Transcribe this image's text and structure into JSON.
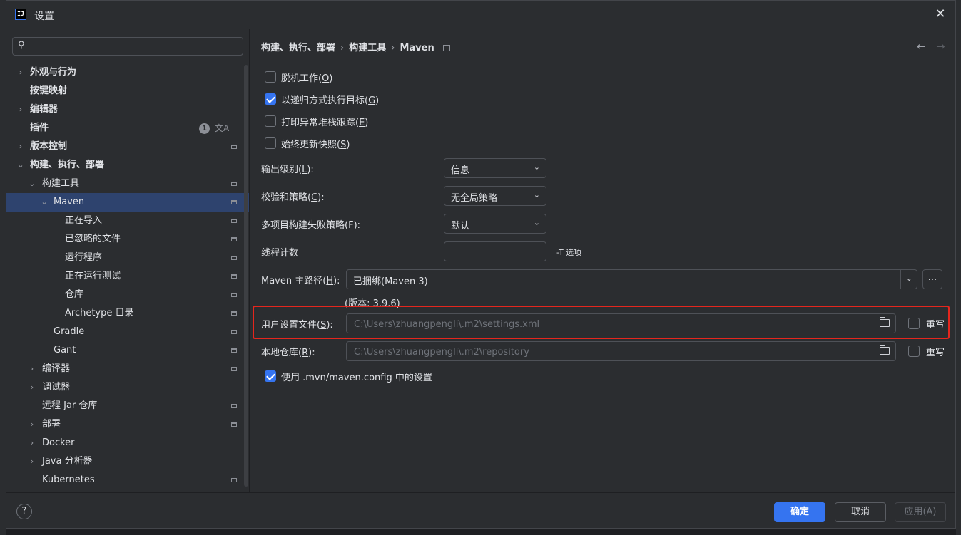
{
  "window": {
    "title": "设置",
    "app_icon": "IJ"
  },
  "search": {
    "placeholder": "",
    "value": ""
  },
  "sidebar": {
    "items": [
      {
        "label": "外观与行为"
      },
      {
        "label": "按键映射"
      },
      {
        "label": "编辑器"
      },
      {
        "label": "插件",
        "badge": "1"
      },
      {
        "label": "版本控制"
      },
      {
        "label": "构建、执行、部署"
      },
      {
        "label": "构建工具"
      },
      {
        "label": "Maven"
      },
      {
        "label": "正在导入"
      },
      {
        "label": "已忽略的文件"
      },
      {
        "label": "运行程序"
      },
      {
        "label": "正在运行测试"
      },
      {
        "label": "仓库"
      },
      {
        "label": "Archetype 目录"
      },
      {
        "label": "Gradle"
      },
      {
        "label": "Gant"
      },
      {
        "label": "编译器"
      },
      {
        "label": "调试器"
      },
      {
        "label": "远程 Jar 仓库"
      },
      {
        "label": "部署"
      },
      {
        "label": "Docker"
      },
      {
        "label": "Java 分析器"
      },
      {
        "label": "Kubernetes"
      }
    ]
  },
  "breadcrumb": {
    "part1": "构建、执行、部署",
    "part2": "构建工具",
    "part3": "Maven",
    "sep": "›"
  },
  "options": {
    "offline": {
      "label": "脱机工作(",
      "key": "O",
      "end": ")",
      "checked": false
    },
    "recursive": {
      "label": "以递归方式执行目标(",
      "key": "G",
      "end": ")",
      "checked": true
    },
    "stacktrace": {
      "label": "打印异常堆栈跟踪(",
      "key": "E",
      "end": ")",
      "checked": false
    },
    "snapshots": {
      "label": "始终更新快照(",
      "key": "S",
      "end": ")",
      "checked": false
    }
  },
  "form": {
    "output_level": {
      "label": "输出级别(",
      "key": "L",
      "end": "):",
      "value": "信息"
    },
    "checksum": {
      "label": "校验和策略(",
      "key": "C",
      "end": "):",
      "value": "无全局策略"
    },
    "fail_policy": {
      "label": "多项目构建失败策略(",
      "key": "F",
      "end": "):",
      "value": "默认"
    },
    "threads": {
      "label": "线程计数",
      "value": "",
      "hint": "-T 选项"
    },
    "maven_home": {
      "label": "Maven 主路径(",
      "key": "H",
      "end": "):",
      "value": "已捆绑(Maven 3)",
      "ellipsis": "...",
      "version": "(版本: 3.9.6)"
    },
    "user_settings": {
      "label": "用户设置文件(",
      "key": "S",
      "end": "):",
      "value": "C:\\Users\\zhuangpengli\\.m2\\settings.xml",
      "override": "重写",
      "override_checked": false
    },
    "local_repo": {
      "label": "本地仓库(",
      "key": "R",
      "end": "):",
      "value": "C:\\Users\\zhuangpengli\\.m2\\repository",
      "override": "重写",
      "override_checked": false
    },
    "mvn_config": {
      "label": "使用 .mvn/maven.config 中的设置",
      "checked": true
    }
  },
  "footer": {
    "help": "?",
    "ok": "确定",
    "cancel": "取消",
    "apply": "应用(A)"
  },
  "colors": {
    "accent": "#3574f0",
    "highlight": "#e5261d",
    "background": "#2b2d30",
    "selection": "#2e436e"
  }
}
